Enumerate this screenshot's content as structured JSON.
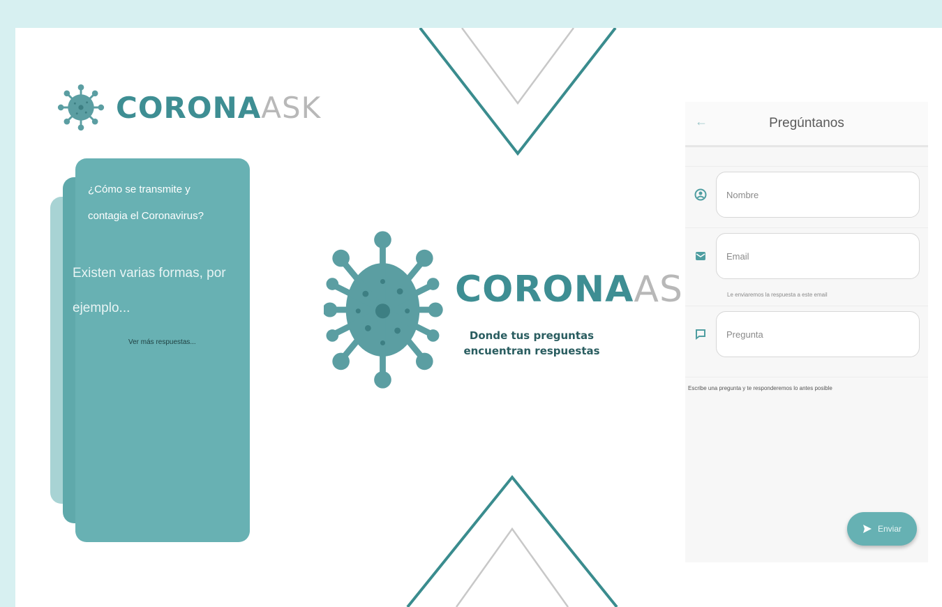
{
  "brand": {
    "word1": "CORONA",
    "word2": "ASK"
  },
  "tagline": {
    "line1": "Donde tus preguntas",
    "line2": "encuentran respuestas"
  },
  "card": {
    "question": "¿Cómo se transmite y contagia el Coronavirus?",
    "answer": "Existen varias formas, por ejemplo...",
    "more": "Ver más respuestas..."
  },
  "form": {
    "title": "Pregúntanos",
    "name_placeholder": "Nombre",
    "email_placeholder": "Email",
    "email_helper": "Le enviaremos la respuesta a este email",
    "question_placeholder": "Pregunta",
    "question_helper": "Escribe una pregunta y te responderemos lo antes posible",
    "send_label": "Enviar"
  },
  "icons": {
    "back": "back-arrow-icon",
    "name": "person-icon",
    "email": "mail-icon",
    "question": "chat-icon",
    "send": "send-icon",
    "logo": "virus-icon"
  },
  "colors": {
    "background": "#d7f0f1",
    "teal": "#3e8e93",
    "card": "#68b1b3",
    "gray": "#b8b8b8"
  }
}
